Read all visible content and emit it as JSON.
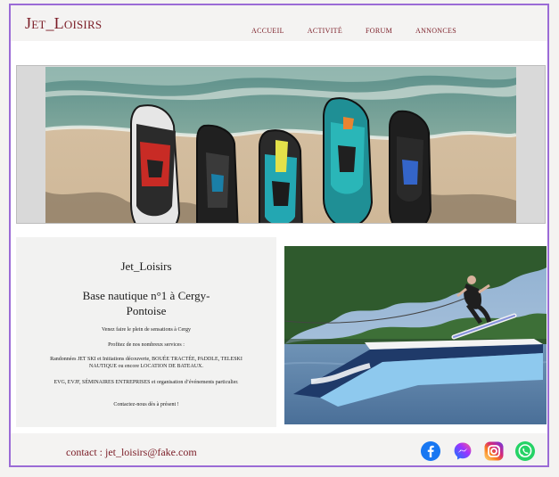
{
  "header": {
    "logo": "Jet_Loisirs",
    "nav": [
      "accueil",
      "activité",
      "forum",
      "annonces"
    ]
  },
  "info": {
    "title": "Jet_Loisirs",
    "subtitle": "Base nautique n°1 à Cergy-Pontoise",
    "paragraphs": [
      "Venez faire le plein de sensations à Cergy",
      "Profitez de nos nombreux services :",
      "Randonnées JET SKI et Initiations découverte, BOUÉE TRACTÉE, PADDLE, TELESKI NAUTIQUE ou encore LOCATION DE BATEAUX.",
      "EVG, EVJF, SÉMINAIRES ENTREPRISES et organisation d’événements particulier.",
      "Contactez-nous dès à présent !"
    ]
  },
  "footer": {
    "contact": "contact : jet_loisirs@fake.com",
    "social": [
      "facebook-icon",
      "messenger-icon",
      "instagram-icon",
      "whatsapp-icon"
    ]
  },
  "colors": {
    "brand": "#7a1b25",
    "frame": "#9b6bd6"
  }
}
